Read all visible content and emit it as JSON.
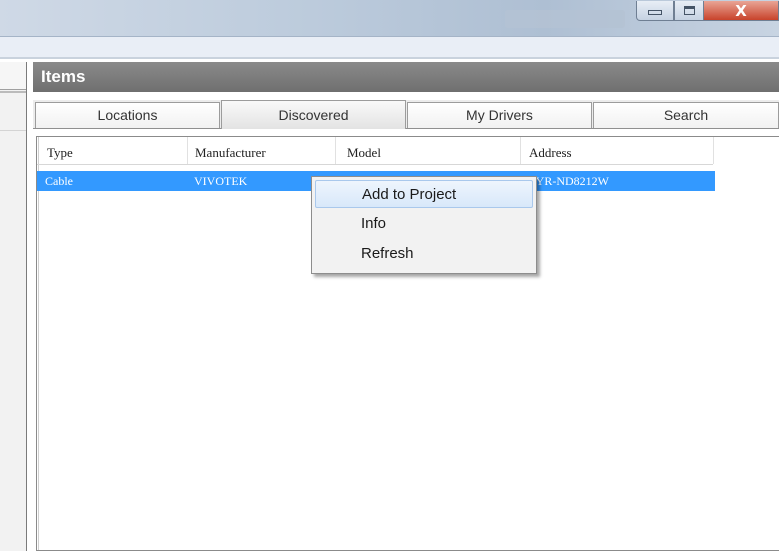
{
  "window": {
    "min_glyph": "",
    "max_glyph": "",
    "close_glyph": "X"
  },
  "items_panel": {
    "title": "Items",
    "tabs": [
      {
        "label": "Locations"
      },
      {
        "label": "Discovered"
      },
      {
        "label": "My Drivers"
      },
      {
        "label": "Search"
      }
    ],
    "active_tab": "Discovered",
    "columns": [
      "Type",
      "Manufacturer",
      "Model",
      "Address"
    ],
    "rows": [
      {
        "type": "Cable",
        "manufacturer": "VIVOTEK",
        "model": "",
        "address": "VYR-ND8212W",
        "selected": true
      }
    ]
  },
  "context_menu": {
    "items": [
      {
        "label": "Add to Project",
        "highlighted": true
      },
      {
        "label": "Info"
      },
      {
        "label": "Refresh"
      }
    ]
  },
  "colors": {
    "selection": "#3399ff",
    "header_bar": "#7d7d7d",
    "close_button": "#c8432b"
  }
}
